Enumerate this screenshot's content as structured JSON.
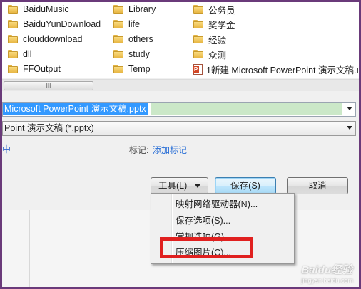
{
  "file_list": {
    "col1": [
      "BaiduMusic",
      "BaiduYunDownload",
      "clouddownload",
      "dll",
      "FFOutput"
    ],
    "col2": [
      "Library",
      "life",
      "others",
      "study",
      "Temp"
    ],
    "col3": [
      "公务员",
      "奖学金",
      "经验",
      "众测",
      "1新建 Microsoft PowerPoint 演示文稿.ı"
    ]
  },
  "hscroll": {
    "thumb_grip": "III"
  },
  "filename": {
    "value": "Microsoft PowerPoint 演示文稿.pptx"
  },
  "save_type": {
    "value": "Point 演示文稿 (*.pptx)"
  },
  "meta": {
    "author_tail": "中",
    "tags_label": "标记:",
    "tags_link": "添加标记"
  },
  "buttons": {
    "tools": "工具(L)",
    "save": "保存(S)",
    "cancel": "取消"
  },
  "tools_menu": [
    "映射网络驱动器(N)...",
    "保存选项(S)...",
    "常规选项(G)...",
    "压缩图片(C)..."
  ],
  "watermark": {
    "text": "Baidu经验",
    "sub": "jingyan.baidu.com"
  },
  "colors": {
    "highlight_box": "#e0201f",
    "selection": "#3399ff",
    "frame": "#6a3a7a"
  }
}
